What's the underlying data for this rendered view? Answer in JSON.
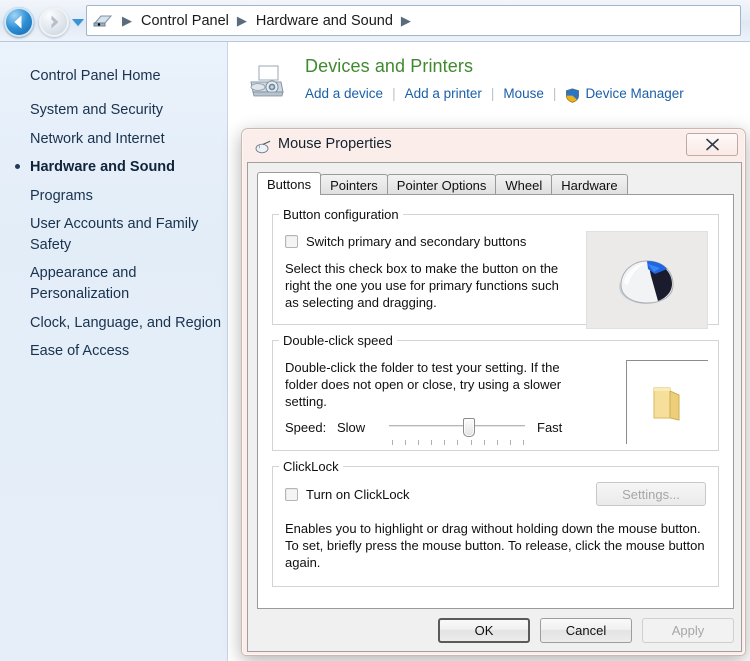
{
  "window": {
    "breadcrumbs": [
      "Control Panel",
      "Hardware and Sound"
    ],
    "nav": {
      "back_icon": "back-arrow-icon",
      "forward_icon": "forward-arrow-icon",
      "dropdown_icon": "recent-pages-chevron-icon",
      "computer_icon": "computer-icon"
    }
  },
  "sidebar": {
    "home_label": "Control Panel Home",
    "items": [
      {
        "label": "System and Security",
        "current": false
      },
      {
        "label": "Network and Internet",
        "current": false
      },
      {
        "label": "Hardware and Sound",
        "current": true
      },
      {
        "label": "Programs",
        "current": false
      },
      {
        "label": "User Accounts and Family Safety",
        "current": false
      },
      {
        "label": "Appearance and Personalization",
        "current": false
      },
      {
        "label": "Clock, Language, and Region",
        "current": false
      },
      {
        "label": "Ease of Access",
        "current": false
      }
    ]
  },
  "content": {
    "section": {
      "icon": "printer-and-camera-icon",
      "title": "Devices and Printers",
      "title_color": "#3f8a2e",
      "links": [
        {
          "label": "Add a device",
          "icon": null
        },
        {
          "label": "Add a printer",
          "icon": null
        },
        {
          "label": "Mouse",
          "icon": null
        },
        {
          "label": "Device Manager",
          "icon": "uac-shield-icon"
        }
      ]
    }
  },
  "dialog": {
    "title": "Mouse Properties",
    "icon": "mouse-icon",
    "close_label": "✕",
    "close_icon": "close-icon",
    "tabs": [
      {
        "label": "Buttons",
        "active": true
      },
      {
        "label": "Pointers",
        "active": false
      },
      {
        "label": "Pointer Options",
        "active": false
      },
      {
        "label": "Wheel",
        "active": false
      },
      {
        "label": "Hardware",
        "active": false
      }
    ],
    "button_configuration": {
      "legend": "Button configuration",
      "checkbox_label": "Switch primary and secondary buttons",
      "checkbox_checked": false,
      "description": "Select this check box to make the button on the right the one you use for primary functions such as selecting and dragging.",
      "preview_icon": "mouse-preview-icon"
    },
    "double_click_speed": {
      "legend": "Double-click speed",
      "description": "Double-click the folder to test your setting. If the folder does not open or close, try using a slower setting.",
      "speed_label": "Speed:",
      "slow_label": "Slow",
      "fast_label": "Fast",
      "slider_value": 55,
      "slider_min": 0,
      "slider_max": 100,
      "tick_count": 11,
      "test_icon": "folder-icon"
    },
    "clicklock": {
      "legend": "ClickLock",
      "checkbox_label": "Turn on ClickLock",
      "checkbox_checked": false,
      "settings_label": "Settings...",
      "settings_enabled": false,
      "description": "Enables you to highlight or drag without holding down the mouse button. To set, briefly press the mouse button. To release, click the mouse button again."
    },
    "buttons": {
      "ok": "OK",
      "cancel": "Cancel",
      "apply": "Apply",
      "apply_enabled": false
    }
  },
  "colors": {
    "accent_link": "#1a5fa8",
    "section_title": "#3f8a2e",
    "sidebar_bg": "#e6eff9",
    "dialog_glass": "#faece8",
    "dialog_body": "#f0f0f0"
  }
}
